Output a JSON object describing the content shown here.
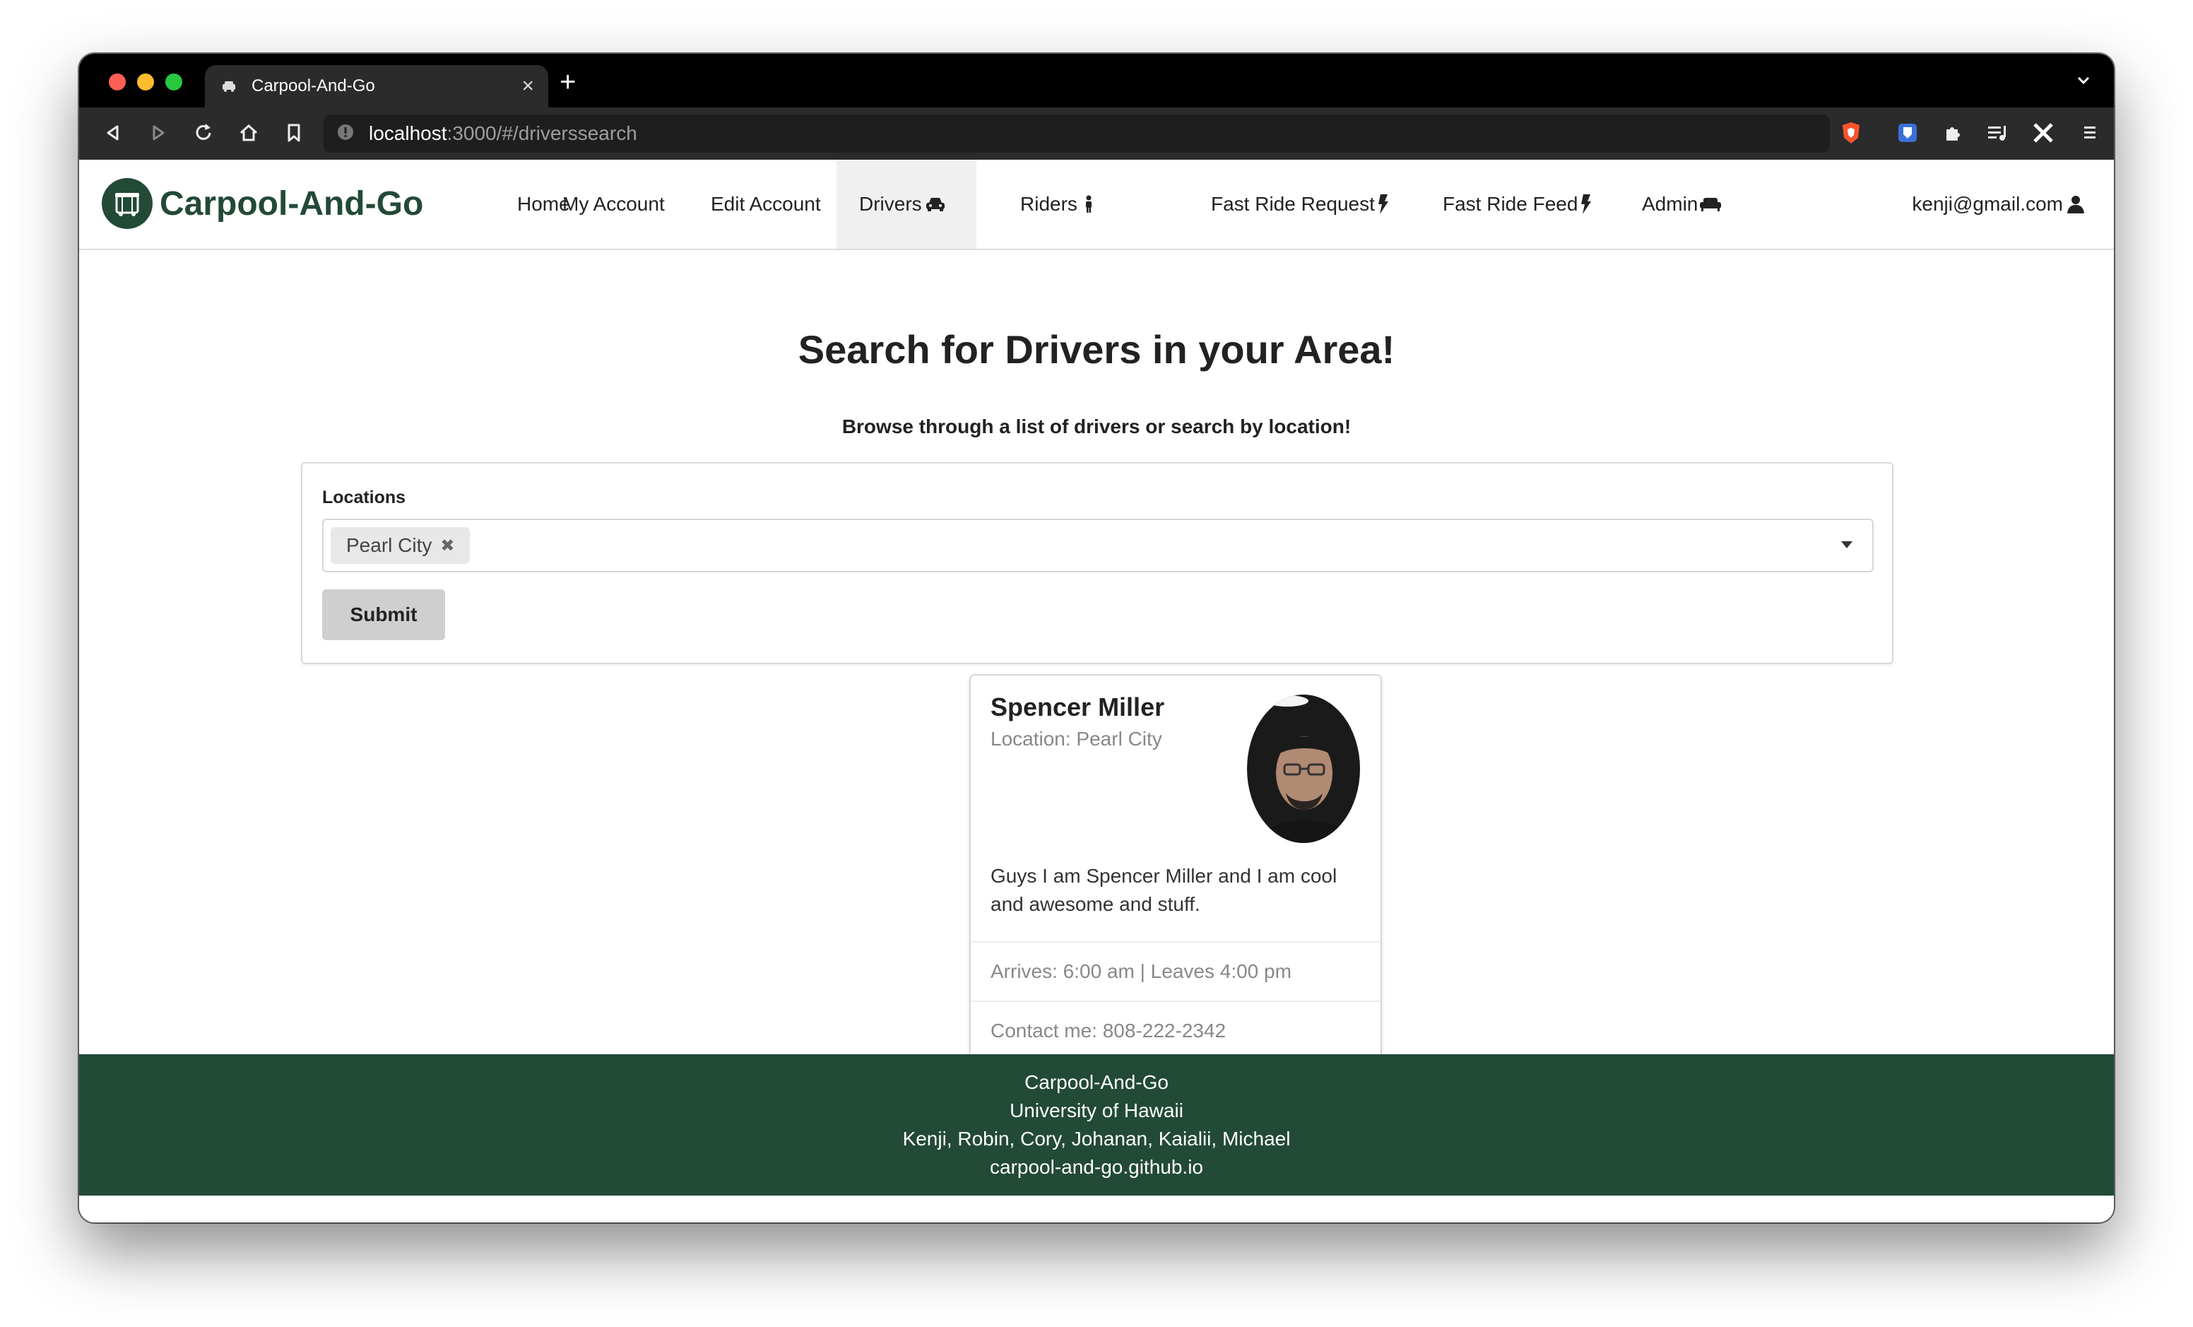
{
  "browser": {
    "tab_title": "Carpool-And-Go",
    "url_host": "localhost",
    "url_rest": ":3000/#/driverssearch"
  },
  "nav": {
    "brand": "Carpool-And-Go",
    "items": [
      {
        "label": "Home"
      },
      {
        "label": "My Account"
      },
      {
        "label": "Edit Account"
      },
      {
        "label": "Drivers",
        "icon": "car-icon"
      },
      {
        "label": "Riders",
        "icon": "person-icon"
      },
      {
        "label": "Fast Ride Request",
        "icon": "bolt-icon"
      },
      {
        "label": "Fast Ride Feed",
        "icon": "bolt-icon"
      },
      {
        "label": "Admin",
        "icon": "couch-icon"
      }
    ],
    "user": "kenji@gmail.com"
  },
  "main": {
    "heading": "Search for Drivers in your Area!",
    "subheading": "Browse through a list of drivers or search by location!",
    "form": {
      "label": "Locations",
      "selected": "Pearl City",
      "submit": "Submit"
    }
  },
  "driver_card": {
    "name": "Spencer Miller",
    "location": "Location: Pearl City",
    "description": "Guys I am Spencer Miller and I am cool and awesome and stuff.",
    "schedule": "Arrives: 6:00 am | Leaves 4:00 pm",
    "contact": "Contact me: 808-222-2342"
  },
  "footer": {
    "lines": [
      "Carpool-And-Go",
      "University of Hawaii",
      "Kenji, Robin, Cory, Johanan, Kaialii, Michael",
      "carpool-and-go.github.io"
    ]
  },
  "colors": {
    "brand": "#224a37",
    "active_nav": "#f0f0f0"
  }
}
